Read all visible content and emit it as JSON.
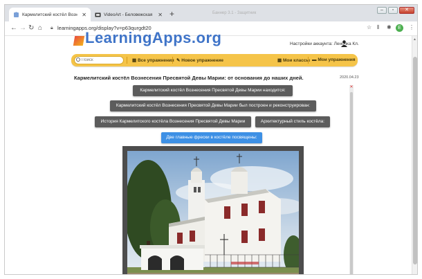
{
  "browser": {
    "tabs": [
      {
        "title": "Кармелитский костёл Вознесен",
        "active": true,
        "icon": "puzzle-icon"
      },
      {
        "title": "VideoArt - Беловежская пуща",
        "active": false,
        "icon": "video-icon"
      }
    ],
    "url": "learningapps.org/display?v=p63qurgdt20",
    "ghost_tab": "Баннер 3.1 - Защитник"
  },
  "site": {
    "logo": "LearningApps.org",
    "account_label": "Настройки аккаунта: Леночка Кл.",
    "search_placeholder": "Поиск",
    "nav": [
      "Все упражнения",
      "Новое упражнение",
      "Мои классы",
      "Мои упражнения"
    ]
  },
  "page": {
    "title": "Кармелитский костёл Вознесения Пресвятой Девы Марии: от основания до наших дней.",
    "date": "2020.04.23",
    "questions": [
      "Кармелитский костёл Вознесения Пресвятой Девы Марии находится:",
      "Кармелитский костёл Вознесения Пресвятой Девы Марии был построен и реконструирован:",
      "История Кармелитского костёла Вознесения Пресвятой Девы Марии",
      "Архитектурный стиль костёла:",
      "Две главные фрески в костёле посвящены:"
    ],
    "active_question_color": "#3d90e5",
    "accent_color": "#f5c449"
  }
}
